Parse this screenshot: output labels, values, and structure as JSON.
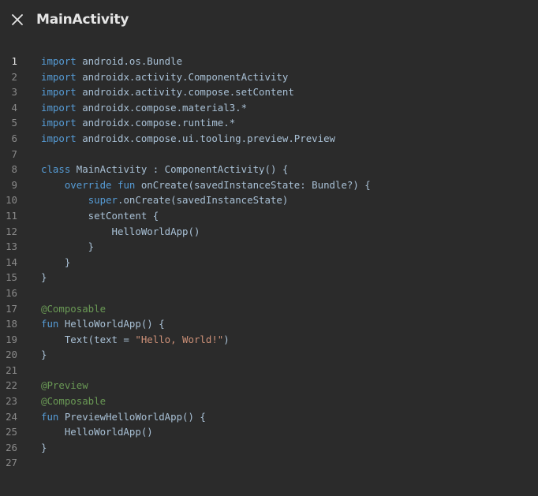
{
  "window": {
    "title": "MainActivity",
    "close_icon": "close-icon"
  },
  "colors": {
    "background": "#2b2b2b",
    "keyword": "#569cd6",
    "identifier": "#a9c1d6",
    "function": "#dcdcaa",
    "string": "#ce9178",
    "annotation": "#6a9955",
    "line_number": "#8a8a8a"
  },
  "editor": {
    "active_line": 1,
    "lines": [
      {
        "n": "1",
        "tokens": [
          [
            "kw",
            "import"
          ],
          [
            "plain",
            " android.os.Bundle"
          ]
        ]
      },
      {
        "n": "2",
        "tokens": [
          [
            "kw",
            "import"
          ],
          [
            "plain",
            " androidx.activity.ComponentActivity"
          ]
        ]
      },
      {
        "n": "3",
        "tokens": [
          [
            "kw",
            "import"
          ],
          [
            "plain",
            " androidx.activity.compose.setContent"
          ]
        ]
      },
      {
        "n": "4",
        "tokens": [
          [
            "kw",
            "import"
          ],
          [
            "plain",
            " androidx.compose.material3.*"
          ]
        ]
      },
      {
        "n": "5",
        "tokens": [
          [
            "kw",
            "import"
          ],
          [
            "plain",
            " androidx.compose.runtime.*"
          ]
        ]
      },
      {
        "n": "6",
        "tokens": [
          [
            "kw",
            "import"
          ],
          [
            "plain",
            " androidx.compose.ui.tooling.preview.Preview"
          ]
        ]
      },
      {
        "n": "7",
        "tokens": []
      },
      {
        "n": "8",
        "tokens": [
          [
            "kw",
            "class"
          ],
          [
            "plain",
            " MainActivity : ComponentActivity() {"
          ]
        ]
      },
      {
        "n": "9",
        "tokens": [
          [
            "plain",
            "    "
          ],
          [
            "kw",
            "override fun"
          ],
          [
            "plain",
            " onCreate(savedInstanceState: Bundle?) {"
          ]
        ]
      },
      {
        "n": "10",
        "tokens": [
          [
            "plain",
            "        "
          ],
          [
            "kw",
            "super"
          ],
          [
            "plain",
            ".onCreate(savedInstanceState)"
          ]
        ]
      },
      {
        "n": "11",
        "tokens": [
          [
            "plain",
            "        setContent {"
          ]
        ]
      },
      {
        "n": "12",
        "tokens": [
          [
            "plain",
            "            HelloWorldApp()"
          ]
        ]
      },
      {
        "n": "13",
        "tokens": [
          [
            "plain",
            "        }"
          ]
        ]
      },
      {
        "n": "14",
        "tokens": [
          [
            "plain",
            "    }"
          ]
        ]
      },
      {
        "n": "15",
        "tokens": [
          [
            "plain",
            "}"
          ]
        ]
      },
      {
        "n": "16",
        "tokens": []
      },
      {
        "n": "17",
        "tokens": [
          [
            "ann",
            "@Composable"
          ]
        ]
      },
      {
        "n": "18",
        "tokens": [
          [
            "kw",
            "fun"
          ],
          [
            "plain",
            " HelloWorldApp() {"
          ]
        ]
      },
      {
        "n": "19",
        "tokens": [
          [
            "plain",
            "    Text(text = "
          ],
          [
            "str",
            "\"Hello, World!\""
          ],
          [
            "plain",
            ")"
          ]
        ]
      },
      {
        "n": "20",
        "tokens": [
          [
            "plain",
            "}"
          ]
        ]
      },
      {
        "n": "21",
        "tokens": []
      },
      {
        "n": "22",
        "tokens": [
          [
            "ann",
            "@Preview"
          ]
        ]
      },
      {
        "n": "23",
        "tokens": [
          [
            "ann",
            "@Composable"
          ]
        ]
      },
      {
        "n": "24",
        "tokens": [
          [
            "kw",
            "fun"
          ],
          [
            "plain",
            " PreviewHelloWorldApp() {"
          ]
        ]
      },
      {
        "n": "25",
        "tokens": [
          [
            "plain",
            "    HelloWorldApp()"
          ]
        ]
      },
      {
        "n": "26",
        "tokens": [
          [
            "plain",
            "}"
          ]
        ]
      },
      {
        "n": "27",
        "tokens": []
      }
    ]
  }
}
